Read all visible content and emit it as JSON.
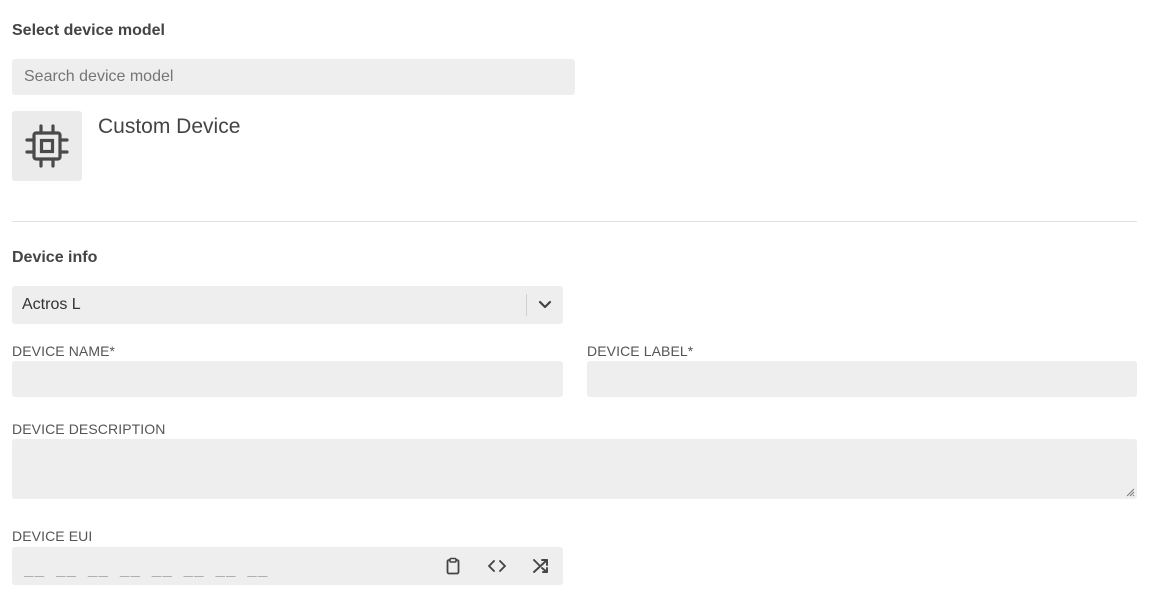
{
  "model_section": {
    "title": "Select device model",
    "search_placeholder": "Search device model",
    "selected_model": {
      "name": "Custom Device",
      "icon": "cpu-chip-icon"
    }
  },
  "device_info": {
    "title": "Device info",
    "device_type": {
      "selected": "Actros L"
    },
    "device_name": {
      "label": "DEVICE NAME*",
      "value": ""
    },
    "device_label": {
      "label": "DEVICE LABEL*",
      "value": ""
    },
    "device_description": {
      "label": "DEVICE DESCRIPTION",
      "value": ""
    },
    "device_eui": {
      "label": "DEVICE EUI",
      "mask": "__ __ __ __ __ __ __ __",
      "actions": [
        "clipboard-icon",
        "code-brackets-icon",
        "shuffle-icon"
      ]
    }
  },
  "colors": {
    "field_bg": "#eeeeee",
    "text": "#3a3a3a",
    "divider": "#e2e2e2"
  }
}
